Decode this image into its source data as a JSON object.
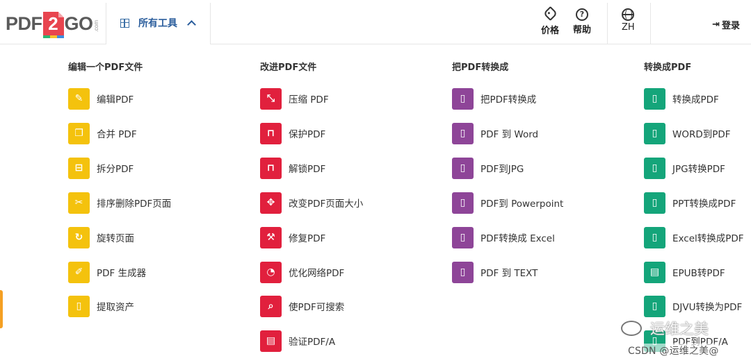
{
  "header": {
    "logo": {
      "left": "PDF",
      "two": "2",
      "right": "GO",
      "com": ".com"
    },
    "tools_label": "所有工具",
    "price_label": "价格",
    "help_label": "帮助",
    "lang_label": "ZH",
    "login_label": "登录"
  },
  "colors": {
    "yellow": "#f4c20d",
    "red": "#e1203d",
    "purple": "#8e4598",
    "green": "#14a57a",
    "accent": "#2a5d9c"
  },
  "menu": {
    "edit": {
      "title": "编辑一个PDF文件",
      "items": [
        {
          "label": "编辑PDF",
          "icon": "pencil-square-icon"
        },
        {
          "label": "合并 PDF",
          "icon": "files-icon"
        },
        {
          "label": "拆分PDF",
          "icon": "split-file-icon"
        },
        {
          "label": "排序删除PDF页面",
          "icon": "scissors-icon"
        },
        {
          "label": "旋转页面",
          "icon": "rotate-icon"
        },
        {
          "label": "PDF 生成器",
          "icon": "file-pencil-icon"
        },
        {
          "label": "提取资产",
          "icon": "file-icon"
        }
      ]
    },
    "improve": {
      "title": "改进PDF文件",
      "items": [
        {
          "label": "压缩 PDF",
          "icon": "compress-icon"
        },
        {
          "label": "保护PDF",
          "icon": "lock-icon"
        },
        {
          "label": "解锁PDF",
          "icon": "unlock-icon"
        },
        {
          "label": "改变PDF页面大小",
          "icon": "move-arrows-icon"
        },
        {
          "label": "修复PDF",
          "icon": "wrench-icon"
        },
        {
          "label": "优化网络PDF",
          "icon": "gauge-icon"
        },
        {
          "label": "使PDF可搜索",
          "icon": "search-icon"
        },
        {
          "label": "验证PDF/A",
          "icon": "archive-icon"
        }
      ]
    },
    "from_pdf": {
      "title": "把PDF转换成",
      "items": [
        {
          "label": "把PDF转换成",
          "icon": "file-pdf-icon"
        },
        {
          "label": "PDF 到 Word",
          "icon": "file-word-icon"
        },
        {
          "label": "PDF到JPG",
          "icon": "file-image-icon"
        },
        {
          "label": "PDF到 Powerpoint",
          "icon": "file-ppt-icon"
        },
        {
          "label": "PDF转换成 Excel",
          "icon": "file-excel-icon"
        },
        {
          "label": "PDF 到 TEXT",
          "icon": "file-text-icon"
        }
      ]
    },
    "to_pdf": {
      "title": "转换成PDF",
      "items": [
        {
          "label": "转换成PDF",
          "icon": "file-pdf-icon"
        },
        {
          "label": "WORD到PDF",
          "icon": "file-word-icon"
        },
        {
          "label": "JPG转换PDF",
          "icon": "file-image-icon"
        },
        {
          "label": "PPT转换成PDF",
          "icon": "file-ppt-icon"
        },
        {
          "label": "Excel转换成PDF",
          "icon": "file-excel-icon"
        },
        {
          "label": "EPUB转PDF",
          "icon": "book-icon"
        },
        {
          "label": "DJVU转换为PDF",
          "icon": "file-image-icon"
        },
        {
          "label": "PDF到PDF/A",
          "icon": "file-pdfa-icon"
        }
      ]
    }
  },
  "watermark": {
    "line1": "运维之美",
    "line2": "CSDN @运维之美@"
  }
}
